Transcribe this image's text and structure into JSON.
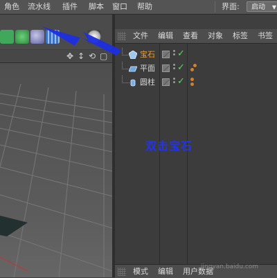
{
  "menubar": {
    "items": [
      "角色",
      "流水线",
      "插件",
      "脚本",
      "窗口",
      "帮助"
    ],
    "interface_label": "界面:",
    "layout_value": "启动"
  },
  "object_manager": {
    "menu": [
      "文件",
      "编辑",
      "查看",
      "对象",
      "标签",
      "书签"
    ],
    "objects": [
      {
        "label": "宝石",
        "icon": "gem-icon",
        "selected": true
      },
      {
        "label": "平面",
        "icon": "plane-icon",
        "selected": false
      },
      {
        "label": "圆柱",
        "icon": "cylinder-icon",
        "selected": false
      }
    ],
    "bottom_tabs": [
      "模式",
      "编辑",
      "用户数据"
    ]
  },
  "annotation": {
    "text": "双击宝石"
  },
  "watermark": {
    "text": "jingyan.baidu.com"
  },
  "colors": {
    "accent_selected": "#f0a030",
    "annotation_blue": "#2233ee",
    "check_green": "#5cdc5c"
  }
}
